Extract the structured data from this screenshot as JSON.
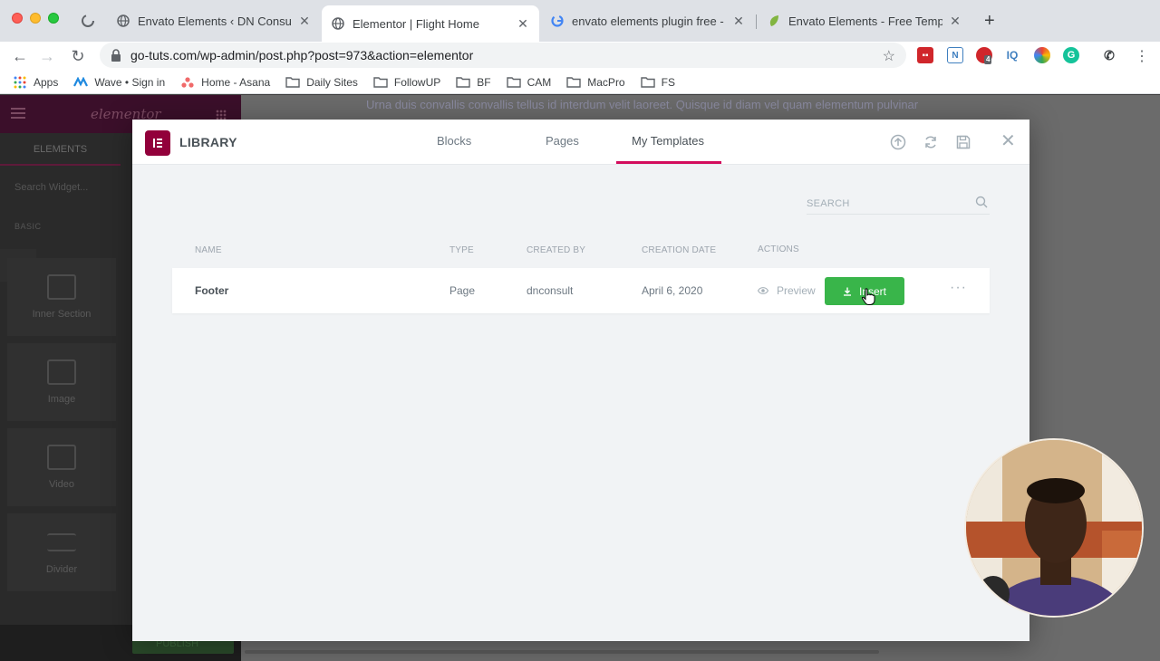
{
  "browser": {
    "tabs": [
      {
        "title": "Envato Elements ‹ DN Consult",
        "active": false
      },
      {
        "title": "Elementor | Flight Home",
        "active": true
      },
      {
        "title": "envato elements plugin free - G",
        "active": false
      },
      {
        "title": "Envato Elements - Free Templa",
        "active": false
      }
    ],
    "url": "go-tuts.com/wp-admin/post.php?post=973&action=elementor",
    "bookmarks": [
      "Apps",
      "Wave • Sign in",
      "Home - Asana",
      "Daily Sites",
      "FollowUP",
      "BF",
      "CAM",
      "MacPro",
      "FS"
    ],
    "extension_badge": "4"
  },
  "editor": {
    "background_text": "Urna duis convallis convallis tellus id interdum velit laoreet. Quisque id diam vel quam elementum pulvinar",
    "panel": {
      "logo": "elementor",
      "tab": "ELEMENTS",
      "search_placeholder": "Search Widget...",
      "category": "BASIC",
      "widgets": [
        "Inner Section",
        "Image",
        "Video",
        "Divider"
      ],
      "publish_label": "PUBLISH"
    }
  },
  "library": {
    "title": "LIBRARY",
    "tabs": [
      "Blocks",
      "Pages",
      "My Templates"
    ],
    "active_tab": "My Templates",
    "search_placeholder": "SEARCH",
    "columns": [
      "NAME",
      "TYPE",
      "CREATED BY",
      "CREATION DATE",
      "ACTIONS"
    ],
    "templates": [
      {
        "name": "Footer",
        "type": "Page",
        "created_by": "dnconsult",
        "creation_date": "April 6, 2020",
        "preview_label": "Preview",
        "insert_label": "Insert"
      }
    ]
  },
  "icons": {
    "header": [
      "upload-icon",
      "sync-icon",
      "save-icon",
      "close-icon"
    ],
    "accent": "#d30c5c",
    "brand": "#92003b",
    "insert_color": "#39b54a"
  }
}
